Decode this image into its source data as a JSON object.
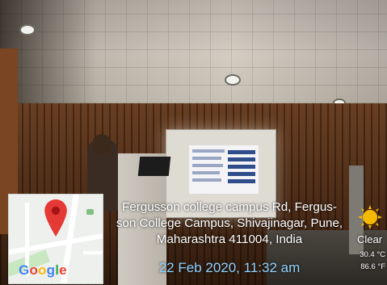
{
  "location": {
    "address_lines": [
      "Fergusson college campus Rd, Fergus-",
      "son College Campus, Shivajinagar, Pune,",
      "Maharashtra 411004, India"
    ],
    "timestamp": "22 Feb 2020, 11:32 am"
  },
  "map": {
    "provider": "Google",
    "pin_color": "#e53935",
    "icon": "location-pin-icon"
  },
  "weather": {
    "icon": "sun-icon",
    "condition": "Clear",
    "temp_c": "30.4 °C",
    "temp_f": "86.6 °F"
  },
  "colors": {
    "timestamp": "#8fd3ff",
    "google_blue": "#4285F4",
    "google_red": "#EA4335",
    "google_yellow": "#FBBC05",
    "google_green": "#34A853"
  }
}
